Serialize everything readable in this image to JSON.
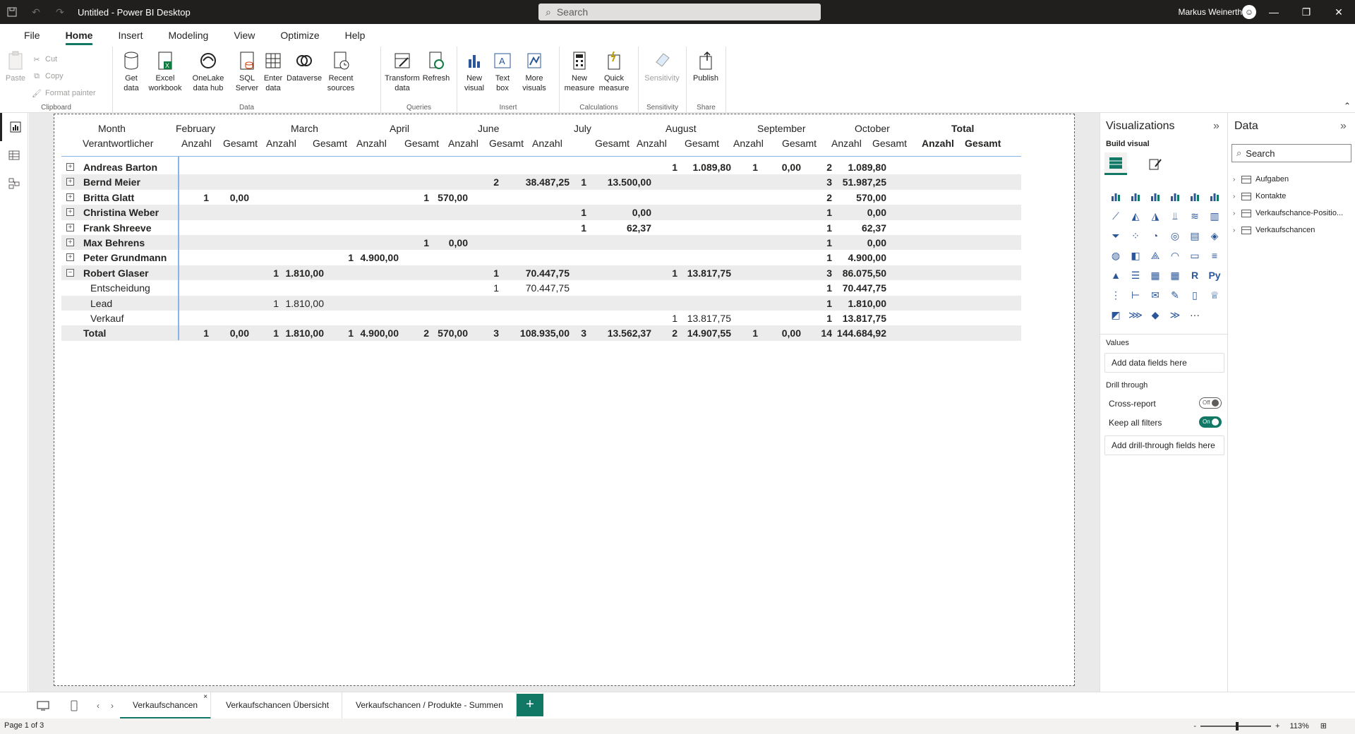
{
  "app": {
    "title": "Untitled - Power BI Desktop",
    "search_placeholder": "Search",
    "user": "Markus Weinerth"
  },
  "menu": {
    "tabs": [
      "File",
      "Home",
      "Insert",
      "Modeling",
      "View",
      "Optimize",
      "Help"
    ],
    "active": "Home"
  },
  "ribbon": {
    "clipboard": {
      "label": "Clipboard",
      "paste": "Paste",
      "cut": "Cut",
      "copy": "Copy",
      "format_painter": "Format painter"
    },
    "data": {
      "label": "Data",
      "get_data": "Get data",
      "excel": "Excel workbook",
      "onelake": "OneLake data hub",
      "sql": "SQL Server",
      "enter": "Enter data",
      "dataverse": "Dataverse",
      "recent": "Recent sources"
    },
    "queries": {
      "label": "Queries",
      "transform": "Transform data",
      "refresh": "Refresh"
    },
    "insert": {
      "label": "Insert",
      "new_visual": "New visual",
      "text_box": "Text box",
      "more_visuals": "More visuals"
    },
    "calculations": {
      "label": "Calculations",
      "new_measure": "New measure",
      "quick_measure": "Quick measure"
    },
    "sensitivity": {
      "label": "Sensitivity",
      "sensitivity": "Sensitivity"
    },
    "share": {
      "label": "Share",
      "publish": "Publish"
    }
  },
  "matrix": {
    "header_row1": {
      "label": "Month",
      "months": [
        "February",
        "March",
        "April",
        "June",
        "July",
        "August",
        "September",
        "October"
      ],
      "total": "Total"
    },
    "header_row2": {
      "label": "Verantwortlicher",
      "anzahl": "Anzahl",
      "gesamt": "Gesamt"
    },
    "rows": [
      {
        "name": "Andreas Barton",
        "expand": "+",
        "level": 0,
        "cells": [
          "",
          "",
          "",
          "",
          "",
          "",
          "",
          "",
          "",
          "",
          "",
          "",
          "1",
          "1.089,80",
          "1",
          "0,00"
        ],
        "total_a": "2",
        "total_g": "1.089,80"
      },
      {
        "name": "Bernd Meier",
        "expand": "+",
        "level": 0,
        "cells": [
          "",
          "",
          "",
          "",
          "",
          "",
          "",
          "",
          "2",
          "38.487,25",
          "1",
          "13.500,00",
          "",
          "",
          "",
          ""
        ],
        "total_a": "3",
        "total_g": "51.987,25"
      },
      {
        "name": "Britta Glatt",
        "expand": "+",
        "level": 0,
        "cells": [
          "1",
          "0,00",
          "",
          "",
          "",
          "",
          "1",
          "570,00",
          "",
          "",
          "",
          "",
          "",
          "",
          "",
          ""
        ],
        "total_a": "2",
        "total_g": "570,00"
      },
      {
        "name": "Christina Weber",
        "expand": "+",
        "level": 0,
        "cells": [
          "",
          "",
          "",
          "",
          "",
          "",
          "",
          "",
          "",
          "",
          "1",
          "0,00",
          "",
          "",
          "",
          ""
        ],
        "total_a": "1",
        "total_g": "0,00"
      },
      {
        "name": "Frank Shreeve",
        "expand": "+",
        "level": 0,
        "cells": [
          "",
          "",
          "",
          "",
          "",
          "",
          "",
          "",
          "",
          "",
          "1",
          "62,37",
          "",
          "",
          "",
          ""
        ],
        "total_a": "1",
        "total_g": "62,37"
      },
      {
        "name": "Max Behrens",
        "expand": "+",
        "level": 0,
        "cells": [
          "",
          "",
          "",
          "",
          "",
          "",
          "1",
          "0,00",
          "",
          "",
          "",
          "",
          "",
          "",
          "",
          ""
        ],
        "total_a": "1",
        "total_g": "0,00"
      },
      {
        "name": "Peter Grundmann",
        "expand": "+",
        "level": 0,
        "cells": [
          "",
          "",
          "",
          "",
          "1",
          "4.900,00",
          "",
          "",
          "",
          "",
          "",
          "",
          "",
          "",
          "",
          ""
        ],
        "total_a": "1",
        "total_g": "4.900,00"
      },
      {
        "name": "Robert Glaser",
        "expand": "−",
        "level": 0,
        "cells": [
          "",
          "",
          "1",
          "1.810,00",
          "",
          "",
          "",
          "",
          "1",
          "70.447,75",
          "",
          "",
          "1",
          "13.817,75",
          "",
          ""
        ],
        "total_a": "3",
        "total_g": "86.075,50"
      },
      {
        "name": "Entscheidung",
        "expand": "",
        "level": 1,
        "cells": [
          "",
          "",
          "",
          "",
          "",
          "",
          "",
          "",
          "1",
          "70.447,75",
          "",
          "",
          "",
          "",
          "",
          ""
        ],
        "total_a": "1",
        "total_g": "70.447,75"
      },
      {
        "name": "Lead",
        "expand": "",
        "level": 1,
        "cells": [
          "",
          "",
          "1",
          "1.810,00",
          "",
          "",
          "",
          "",
          "",
          "",
          "",
          "",
          "",
          "",
          "",
          ""
        ],
        "total_a": "1",
        "total_g": "1.810,00"
      },
      {
        "name": "Verkauf",
        "expand": "",
        "level": 1,
        "cells": [
          "",
          "",
          "",
          "",
          "",
          "",
          "",
          "",
          "",
          "",
          "",
          "",
          "1",
          "13.817,75",
          "",
          ""
        ],
        "total_a": "1",
        "total_g": "13.817,75"
      },
      {
        "name": "Total",
        "expand": "",
        "level": 0,
        "cells": [
          "1",
          "0,00",
          "1",
          "1.810,00",
          "1",
          "4.900,00",
          "2",
          "570,00",
          "3",
          "108.935,00",
          "3",
          "13.562,37",
          "2",
          "14.907,55",
          "1",
          "0,00"
        ],
        "total_a": "14",
        "total_g": "144.684,92"
      }
    ]
  },
  "visualizations": {
    "title": "Visualizations",
    "build_visual": "Build visual",
    "values_title": "Values",
    "values_well": "Add data fields here",
    "drill_title": "Drill through",
    "cross_report": "Cross-report",
    "cross_report_state": "Off",
    "keep_filters": "Keep all filters",
    "keep_filters_state": "On",
    "drill_well": "Add drill-through fields here",
    "r_label": "R",
    "py_label": "Py",
    "more_label": "···"
  },
  "data_pane": {
    "title": "Data",
    "search_placeholder": "Search",
    "tables": [
      "Aufgaben",
      "Kontakte",
      "Verkaufschance-Positio...",
      "Verkaufschancen"
    ]
  },
  "pages": {
    "tabs": [
      "Verkaufschancen",
      "Verkaufschancen Übersicht",
      "Verkaufschancen / Produkte - Summen"
    ],
    "active": "Verkaufschancen",
    "close": "×",
    "add": "+"
  },
  "status": {
    "page": "Page 1 of 3",
    "zoom": "113%",
    "zoom_minus": "-",
    "zoom_plus": "+"
  },
  "colors": {
    "accent": "#117865",
    "titlebar": "#201f1e"
  }
}
